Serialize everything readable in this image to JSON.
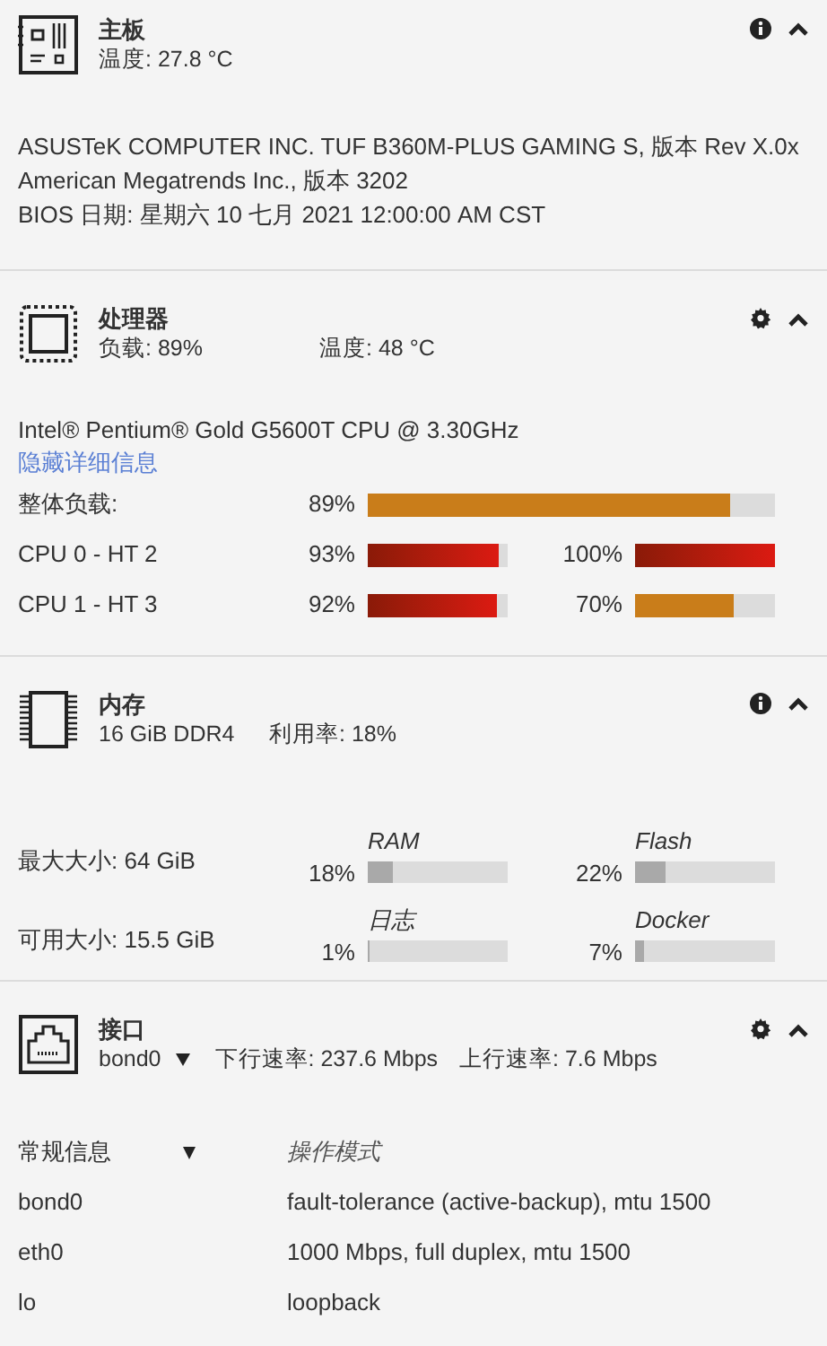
{
  "motherboard": {
    "title": "主板",
    "subtitle": [
      "温度: 27.8 °C"
    ],
    "details": [
      "ASUSTeK COMPUTER INC. TUF B360M-PLUS GAMING S, 版本 Rev X.0x",
      "American Megatrends Inc., 版本 3202",
      "BIOS 日期: 星期六 10 七月 2021 12:00:00 AM CST"
    ]
  },
  "processor": {
    "title": "处理器",
    "subtitle": [
      "负载: 89%",
      "温度: 48 °C"
    ],
    "model": "Intel® Pentium® Gold G5600T CPU @ 3.30GHz",
    "link": "隐藏详细信息",
    "rows": [
      {
        "label": "整体负载:",
        "meters": [
          {
            "reading": "89%",
            "level": 0.89,
            "kind": "normal"
          }
        ]
      },
      {
        "label": "CPU 0 - HT 2",
        "meters": [
          {
            "reading": "93%",
            "level": 0.93,
            "kind": "high"
          },
          {
            "reading": "100%",
            "level": 1.0,
            "kind": "high"
          }
        ]
      },
      {
        "label": "CPU 1 - HT 3",
        "meters": [
          {
            "reading": "92%",
            "level": 0.92,
            "kind": "high"
          },
          {
            "reading": "70%",
            "level": 0.7,
            "kind": "normal"
          }
        ]
      }
    ]
  },
  "memory": {
    "title": "内存",
    "subtitle": [
      "16 GiB DDR4",
      "利用率: 18%"
    ],
    "rows": [
      {
        "label": "最大大小: 64 GiB",
        "meters": [
          {
            "name": "RAM",
            "reading": "18%",
            "level": 0.18
          },
          {
            "name": "Flash",
            "reading": "22%",
            "level": 0.22
          }
        ]
      },
      {
        "label": "可用大小: 15.5 GiB",
        "meters": [
          {
            "name": "日志",
            "reading": "1%",
            "level": 0.01
          },
          {
            "name": "Docker",
            "reading": "7%",
            "level": 0.07
          }
        ]
      }
    ]
  },
  "interfaces": {
    "title": "接口",
    "selected": "bond0",
    "subtitle": [
      "下行速率: 237.6 Mbps",
      "上行速率: 7.6 Mbps"
    ],
    "columns": [
      "常规信息",
      "操作模式"
    ],
    "rows": [
      [
        "bond0",
        "fault-tolerance (active-backup), mtu 1500"
      ],
      [
        "eth0",
        "1000 Mbps, full duplex, mtu 1500"
      ],
      [
        "lo",
        "loopback"
      ]
    ]
  }
}
